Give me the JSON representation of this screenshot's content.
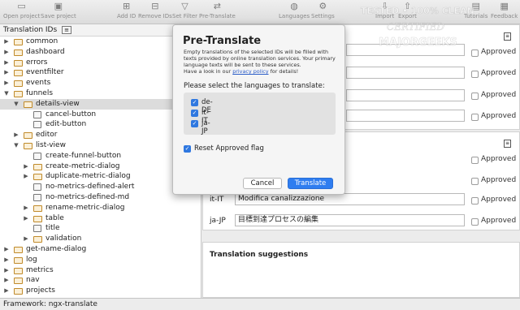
{
  "toolbar": {
    "open_project": "Open project",
    "save_project": "Save project",
    "add_id": "Add ID",
    "remove_ids": "Remove IDs",
    "set_filter": "Set Filter",
    "pre_translate": "Pre-Translate",
    "languages": "Languages",
    "settings": "Settings",
    "import": "Import",
    "export": "Export",
    "tutorials": "Tutorials",
    "feedback": "Feedback"
  },
  "sidebar": {
    "header": "Translation IDs",
    "items": [
      {
        "label": "common",
        "level": 0,
        "type": "folder",
        "expanded": false
      },
      {
        "label": "dashboard",
        "level": 0,
        "type": "folder",
        "expanded": false
      },
      {
        "label": "errors",
        "level": 0,
        "type": "folder",
        "expanded": false
      },
      {
        "label": "eventfilter",
        "level": 0,
        "type": "folder",
        "expanded": false
      },
      {
        "label": "events",
        "level": 0,
        "type": "folder",
        "expanded": false
      },
      {
        "label": "funnels",
        "level": 0,
        "type": "folder",
        "expanded": true
      },
      {
        "label": "details-view",
        "level": 1,
        "type": "folder",
        "expanded": true,
        "selected": true
      },
      {
        "label": "cancel-button",
        "level": 2,
        "type": "id"
      },
      {
        "label": "edit-button",
        "level": 2,
        "type": "id"
      },
      {
        "label": "editor",
        "level": 1,
        "type": "folder",
        "expanded": false
      },
      {
        "label": "list-view",
        "level": 1,
        "type": "folder",
        "expanded": true
      },
      {
        "label": "create-funnel-button",
        "level": 2,
        "type": "id"
      },
      {
        "label": "create-metric-dialog",
        "level": 2,
        "type": "folder",
        "expanded": false
      },
      {
        "label": "duplicate-metric-dialog",
        "level": 2,
        "type": "folder",
        "expanded": false
      },
      {
        "label": "no-metrics-defined-alert",
        "level": 2,
        "type": "id"
      },
      {
        "label": "no-metrics-defined-md",
        "level": 2,
        "type": "id"
      },
      {
        "label": "rename-metric-dialog",
        "level": 2,
        "type": "folder",
        "expanded": false
      },
      {
        "label": "table",
        "level": 2,
        "type": "folder",
        "expanded": false
      },
      {
        "label": "title",
        "level": 2,
        "type": "id"
      },
      {
        "label": "validation",
        "level": 2,
        "type": "folder",
        "expanded": false
      },
      {
        "label": "get-name-dialog",
        "level": 0,
        "type": "folder",
        "expanded": false
      },
      {
        "label": "log",
        "level": 0,
        "type": "folder",
        "expanded": false
      },
      {
        "label": "metrics",
        "level": 0,
        "type": "folder",
        "expanded": false
      },
      {
        "label": "nav",
        "level": 0,
        "type": "folder",
        "expanded": false
      },
      {
        "label": "projects",
        "level": 0,
        "type": "folder",
        "expanded": false
      }
    ]
  },
  "editor": {
    "approved_label": "Approved",
    "section2_rows": [
      {
        "lang": "it-IT",
        "value": "Modifica canalizzazione"
      },
      {
        "lang": "ja-JP",
        "value": "目標到達プロセスの編集"
      }
    ],
    "suggestions_title": "Translation suggestions"
  },
  "status": {
    "text": "Framework: ngx-translate"
  },
  "watermark": {
    "line1": "TESTED • 100% CLEAN",
    "line2": "CERTIFIED",
    "line3": "MAJORGEEKS"
  },
  "dialog": {
    "title": "Pre-Translate",
    "description": "Empty translations of the selected IDs will be filled with texts provided by online translation services. Your primary language texts will be sent to these services.",
    "privacy_prefix": "Have a look in our ",
    "privacy_link": "privacy policy",
    "privacy_suffix": " for details!",
    "prompt": "Please select the languages to translate:",
    "languages": [
      {
        "code": "de-DE",
        "checked": true
      },
      {
        "code": "it-IT",
        "checked": true
      },
      {
        "code": "ja-JP",
        "checked": true
      }
    ],
    "reset_label": "Reset Approved flag",
    "reset_checked": true,
    "cancel_label": "Cancel",
    "translate_label": "Translate"
  }
}
